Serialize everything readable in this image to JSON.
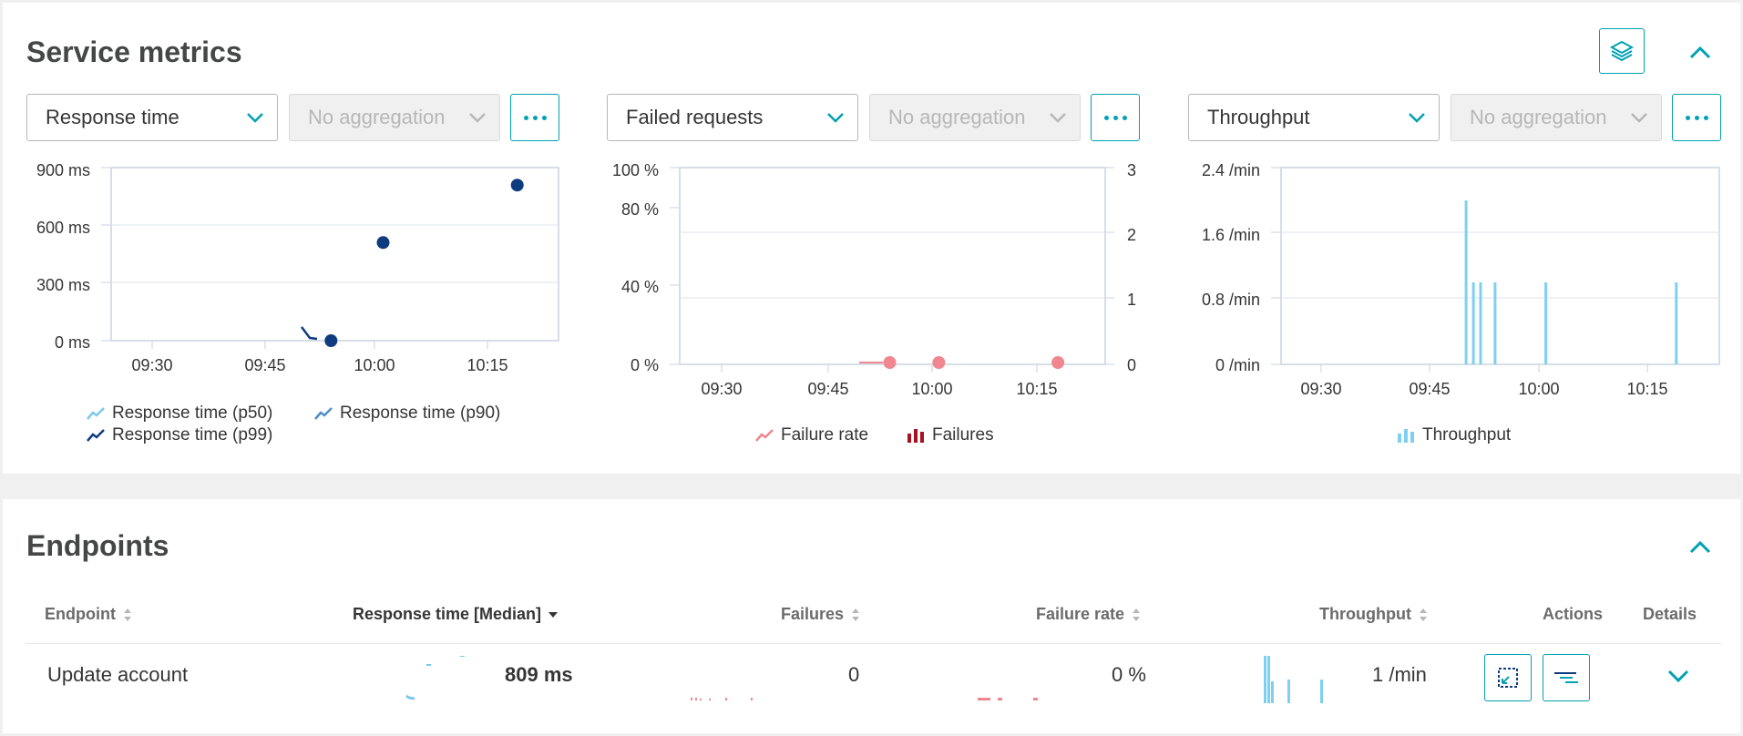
{
  "service_metrics": {
    "title": "Service metrics",
    "charts": [
      {
        "metric_select": "Response time",
        "aggregation_select": "No aggregation",
        "y_ticks": [
          "900 ms",
          "600 ms",
          "300 ms",
          "0 ms"
        ],
        "x_ticks": [
          "09:30",
          "09:45",
          "10:00",
          "10:15"
        ],
        "legend": [
          "Response time (p50)",
          "Response time (p90)",
          "Response time (p99)"
        ]
      },
      {
        "metric_select": "Failed requests",
        "aggregation_select": "No aggregation",
        "y_ticks": [
          "100 %",
          "80 %",
          "40 %",
          "0 %"
        ],
        "y2_ticks": [
          "3",
          "2",
          "1",
          "0"
        ],
        "x_ticks": [
          "09:30",
          "09:45",
          "10:00",
          "10:15"
        ],
        "legend": [
          "Failure rate",
          "Failures"
        ]
      },
      {
        "metric_select": "Throughput",
        "aggregation_select": "No aggregation",
        "y_ticks": [
          "2.4 /min",
          "1.6 /min",
          "0.8 /min",
          "0 /min"
        ],
        "x_ticks": [
          "09:30",
          "09:45",
          "10:00",
          "10:15"
        ],
        "legend": [
          "Throughput"
        ]
      }
    ]
  },
  "endpoints": {
    "title": "Endpoints",
    "columns": [
      "Endpoint",
      "Response time [Median]",
      "Failures",
      "Failure rate",
      "Throughput",
      "Actions",
      "Details"
    ],
    "rows": [
      {
        "endpoint": "Update account",
        "response_time": "809 ms",
        "failures": "0",
        "failure_rate": "0 %",
        "throughput": "1 /min"
      }
    ]
  },
  "colors": {
    "accent": "#00a1b2",
    "p50": "#7dc9ec",
    "p90": "#4f8fc7",
    "p99": "#0e3c7f",
    "failure_rate": "#f0868f",
    "failures": "#a8121f",
    "throughput": "#7dd0f0"
  },
  "chart_data": [
    {
      "type": "scatter",
      "xlabel": "",
      "ylabel": "",
      "ylim": [
        0,
        900
      ],
      "series": [
        {
          "values": [
            {
              "x": "09:54",
              "y": 0
            },
            {
              "x": "10:01",
              "y": 510
            },
            {
              "x": "10:19",
              "y": 809
            }
          ]
        }
      ]
    },
    {
      "type": "scatter",
      "ylim": [
        0,
        100
      ],
      "series": [
        {
          "values": [
            {
              "x": "09:54",
              "y": 0
            },
            {
              "x": "10:01",
              "y": 0
            },
            {
              "x": "10:18",
              "y": 0
            }
          ]
        }
      ]
    },
    {
      "type": "bar",
      "ylim": [
        0,
        2.4
      ],
      "series": [
        {
          "values": [
            {
              "x": "09:50",
              "y": 2
            },
            {
              "x": "09:51",
              "y": 1
            },
            {
              "x": "09:52",
              "y": 1
            },
            {
              "x": "09:54",
              "y": 1
            },
            {
              "x": "10:01",
              "y": 1
            },
            {
              "x": "10:19",
              "y": 1
            }
          ]
        }
      ]
    }
  ]
}
